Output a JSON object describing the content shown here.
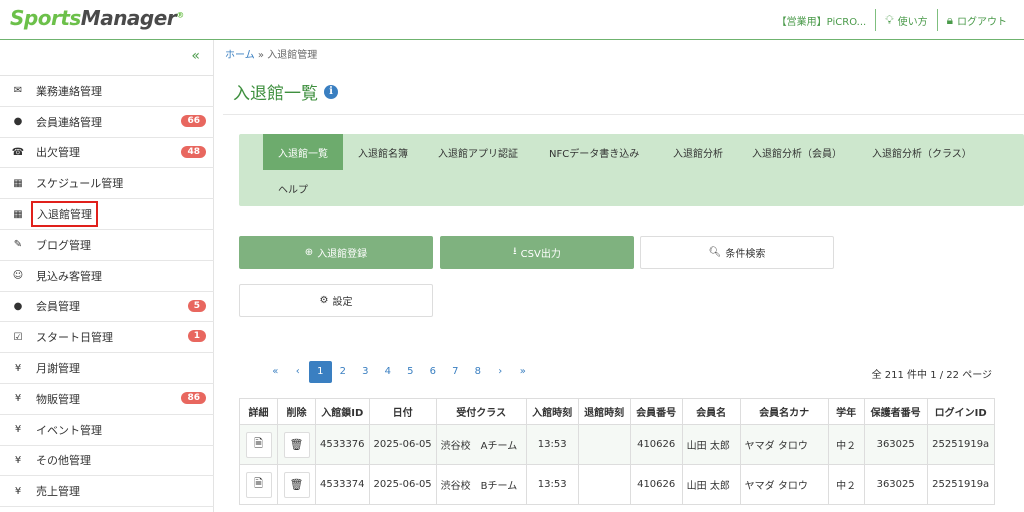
{
  "header": {
    "logo_sports": "Sports",
    "logo_manager": "Manager",
    "account": "【営業用】PiCRO...",
    "help": "使い方",
    "logout": "ログアウト"
  },
  "sidebar": {
    "collapse": "«",
    "items": [
      {
        "icon": "✉",
        "label": "業務連絡管理",
        "badge": ""
      },
      {
        "icon": "●",
        "label": "会員連絡管理",
        "badge": "66"
      },
      {
        "icon": "☎",
        "label": "出欠管理",
        "badge": "48"
      },
      {
        "icon": "▦",
        "label": "スケジュール管理",
        "badge": ""
      },
      {
        "icon": "▦",
        "label": "入退館管理",
        "badge": ""
      },
      {
        "icon": "✎",
        "label": "ブログ管理",
        "badge": ""
      },
      {
        "icon": "☺",
        "label": "見込み客管理",
        "badge": ""
      },
      {
        "icon": "●",
        "label": "会員管理",
        "badge": "5"
      },
      {
        "icon": "☑",
        "label": "スタート日管理",
        "badge": "1"
      },
      {
        "icon": "¥",
        "label": "月謝管理",
        "badge": ""
      },
      {
        "icon": "¥",
        "label": "物販管理",
        "badge": "86"
      },
      {
        "icon": "¥",
        "label": "イベント管理",
        "badge": ""
      },
      {
        "icon": "¥",
        "label": "その他管理",
        "badge": ""
      },
      {
        "icon": "¥",
        "label": "売上管理",
        "badge": ""
      }
    ]
  },
  "breadcrumb": {
    "home": "ホーム",
    "sep": "»",
    "current": "入退館管理"
  },
  "page": {
    "title": "入退館一覧",
    "info": "i"
  },
  "tabs": [
    "入退館一覧",
    "入退館名簿",
    "入退館アプリ認証",
    "NFCデータ書き込み",
    "入退館分析",
    "入退館分析（会員）",
    "入退館分析（クラス）",
    "ヘルプ"
  ],
  "buttons": {
    "register": "入退館登録",
    "csv": "CSV出力",
    "search": "条件検索",
    "settings": "設定"
  },
  "pagination": {
    "first": "«",
    "prev": "‹",
    "next": "›",
    "last": "»",
    "pages": [
      "1",
      "2",
      "3",
      "4",
      "5",
      "6",
      "7",
      "8"
    ],
    "current": "1",
    "info": "全 211 件中 1 / 22 ページ"
  },
  "table": {
    "headers": [
      "詳細",
      "削除",
      "入館鎖ID",
      "日付",
      "受付クラス",
      "入館時刻",
      "退館時刻",
      "会員番号",
      "会員名",
      "会員名カナ",
      "学年",
      "保護者番号",
      "ログインID"
    ],
    "rows": [
      [
        "",
        "",
        "4533376",
        "2025-06-05",
        "渋谷校　Aチーム",
        "13:53",
        "",
        "410626",
        "山田 太郎",
        "ヤマダ タロウ",
        "中２",
        "363025",
        "25251919a"
      ],
      [
        "",
        "",
        "4533374",
        "2025-06-05",
        "渋谷校　Bチーム",
        "13:53",
        "",
        "410626",
        "山田 太郎",
        "ヤマダ タロウ",
        "中２",
        "363025",
        "25251919a"
      ]
    ]
  },
  "colors": {
    "brand_green": "#3e8f3e",
    "tab_active": "#6dab6d",
    "badge_red": "#e8675f",
    "link_blue": "#3a7fc1"
  }
}
